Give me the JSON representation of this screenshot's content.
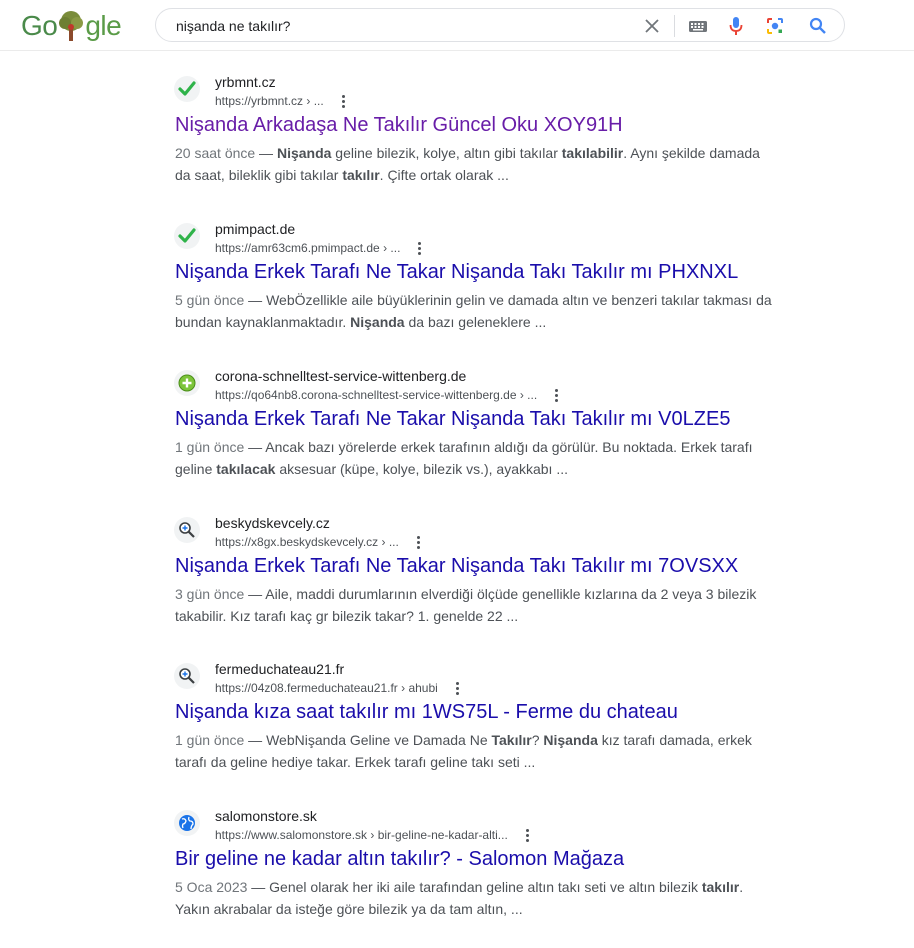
{
  "search": {
    "query": "nişanda ne takılır?",
    "logo_left": "Go",
    "logo_right": "gle"
  },
  "results": [
    {
      "site": "yrbmnt.cz",
      "url": "https://yrbmnt.cz › ...",
      "title": "Nişanda Arkadaşa Ne Takılır Güncel Oku XOY91H",
      "visited": true,
      "favicon": "green-check-icon",
      "date": "20 saat önce",
      "snippet": [
        {
          "t": " — "
        },
        {
          "t": "Nişanda",
          "b": true
        },
        {
          "t": " geline bilezik, kolye, altın gibi takılar "
        },
        {
          "t": "takılabilir",
          "b": true
        },
        {
          "t": ". Aynı şekilde damada da saat, bileklik gibi takılar "
        },
        {
          "t": "takılır",
          "b": true
        },
        {
          "t": ". Çifte ortak olarak ..."
        }
      ]
    },
    {
      "site": "pmimpact.de",
      "url": "https://amr63cm6.pmimpact.de › ...",
      "title": "Nişanda Erkek Tarafı Ne Takar Nişanda Takı Takılır mı PHXNXL",
      "visited": false,
      "favicon": "green-check-icon",
      "date": "5 gün önce",
      "snippet": [
        {
          "t": " — WebÖzellikle aile büyüklerinin gelin ve damada altın ve benzeri takılar takması da bundan kaynaklanmaktadır. "
        },
        {
          "t": "Nişanda",
          "b": true
        },
        {
          "t": " da bazı geleneklere ..."
        }
      ]
    },
    {
      "site": "corona-schnelltest-service-wittenberg.de",
      "url": "https://qo64nb8.corona-schnelltest-service-wittenberg.de › ...",
      "title": "Nişanda Erkek Tarafı Ne Takar Nişanda Takı Takılır mı V0LZE5",
      "visited": false,
      "favicon": "green-plus-icon",
      "date": "1 gün önce",
      "snippet": [
        {
          "t": " — Ancak bazı yörelerde erkek tarafının aldığı da görülür. Bu noktada. Erkek tarafı geline "
        },
        {
          "t": "takılacak",
          "b": true
        },
        {
          "t": " aksesuar (küpe, kolye, bilezik vs.), ayakkabı ..."
        }
      ]
    },
    {
      "site": "beskydskevcely.cz",
      "url": "https://x8gx.beskydskevcely.cz › ...",
      "title": "Nişanda Erkek Tarafı Ne Takar Nişanda Takı Takılır mı 7OVSXX",
      "visited": false,
      "favicon": "magnifier-plus-icon",
      "date": "3 gün önce",
      "snippet": [
        {
          "t": " — Aile, maddi durumlarının elverdiği ölçüde genellikle kızlarına da 2 veya 3 bilezik takabilir. Kız tarafı kaç gr bilezik takar? 1. genelde 22 ..."
        }
      ]
    },
    {
      "site": "fermeduchateau21.fr",
      "url": "https://04z08.fermeduchateau21.fr › ahubi",
      "title": "Nişanda kıza saat takılır mı 1WS75L - Ferme du chateau",
      "visited": false,
      "favicon": "magnifier-plus-icon",
      "date": "1 gün önce",
      "snippet": [
        {
          "t": " — WebNişanda Geline ve Damada Ne "
        },
        {
          "t": "Takılır",
          "b": true
        },
        {
          "t": "? "
        },
        {
          "t": "Nişanda",
          "b": true
        },
        {
          "t": " kız tarafı damada, erkek tarafı da geline hediye takar. Erkek tarafı geline takı seti ..."
        }
      ]
    },
    {
      "site": "salomonstore.sk",
      "url": "https://www.salomonstore.sk › bir-geline-ne-kadar-alti...",
      "title": "Bir geline ne kadar altın takılır? - Salomon Mağaza",
      "visited": false,
      "favicon": "globe-icon",
      "date": "5 Oca 2023",
      "snippet": [
        {
          "t": " — Genel olarak her iki aile tarafından geline altın takı seti ve altın bilezik "
        },
        {
          "t": "takılır",
          "b": true
        },
        {
          "t": ". Yakın akrabalar da isteğe göre bilezik ya da tam altın, ..."
        }
      ]
    }
  ]
}
